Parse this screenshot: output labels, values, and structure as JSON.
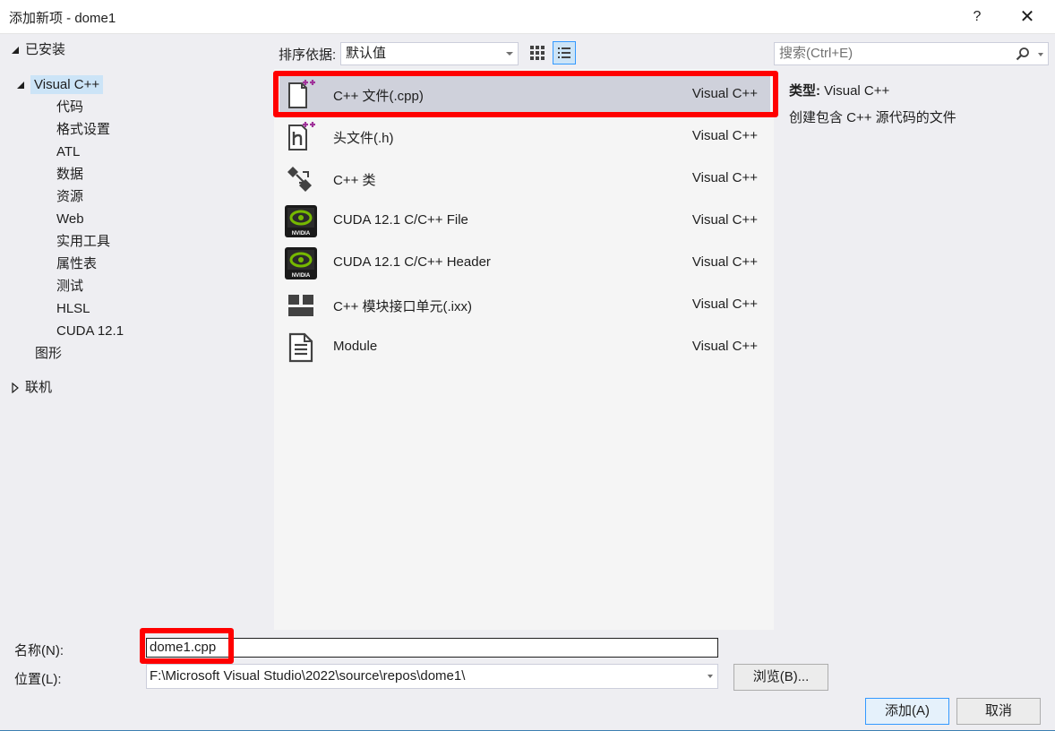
{
  "window": {
    "title": "添加新项 - dome1",
    "help_label": "?",
    "close_label": "✕"
  },
  "tree": {
    "installed_label": "已安装",
    "visual_cpp_label": "Visual C++",
    "children": [
      "代码",
      "格式设置",
      "ATL",
      "数据",
      "资源",
      "Web",
      "实用工具",
      "属性表",
      "测试",
      "HLSL",
      "CUDA 12.1"
    ],
    "graphics_label": "图形",
    "online_label": "联机"
  },
  "toolbar": {
    "sort_label": "排序依据:",
    "sort_value": "默认值",
    "search_placeholder": "搜索(Ctrl+E)"
  },
  "templates": [
    {
      "name": "C++ 文件(.cpp)",
      "type": "Visual C++",
      "icon": "cpp-file-icon"
    },
    {
      "name": "头文件(.h)",
      "type": "Visual C++",
      "icon": "header-file-icon"
    },
    {
      "name": "C++ 类",
      "type": "Visual C++",
      "icon": "cpp-class-icon"
    },
    {
      "name": "CUDA 12.1 C/C++ File",
      "type": "Visual C++",
      "icon": "nvidia-icon"
    },
    {
      "name": "CUDA 12.1 C/C++ Header",
      "type": "Visual C++",
      "icon": "nvidia-icon"
    },
    {
      "name": "C++ 模块接口单元(.ixx)",
      "type": "Visual C++",
      "icon": "module-interface-icon"
    },
    {
      "name": "Module",
      "type": "Visual C++",
      "icon": "document-icon"
    }
  ],
  "details": {
    "type_label": "类型:",
    "type_value": "Visual C++",
    "description": "创建包含 C++ 源代码的文件"
  },
  "form": {
    "name_label": "名称(N):",
    "name_value": "dome1.cpp",
    "location_label": "位置(L):",
    "location_value": "F:\\Microsoft Visual Studio\\2022\\source\\repos\\dome1\\",
    "browse_label": "浏览(B)...",
    "add_label": "添加(A)",
    "cancel_label": "取消"
  },
  "colors": {
    "highlight": "#ff0000",
    "selected_item_bg": "#cfd1db",
    "tree_selected_bg": "#cce4f7",
    "dialog_bg": "#eeeef2",
    "accent": "#3399ff"
  }
}
